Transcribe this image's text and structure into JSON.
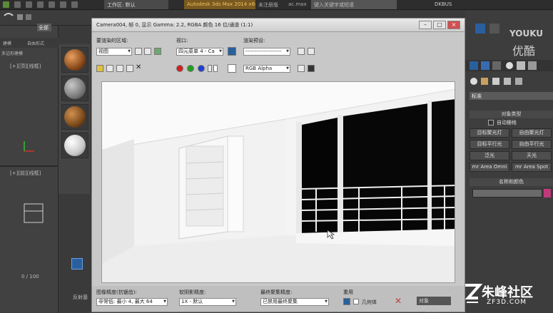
{
  "topbar": {
    "workspace": "工作区: 默认",
    "app_title": "Autodesk 3ds Max  2014 x64",
    "doc_name": "未注册版",
    "doc_file": "ac.max",
    "search_placeholder": "键入关键字或短语",
    "user": "DKBUS"
  },
  "left": {
    "selection_filter": "全部",
    "tab1": "建模",
    "tab2": "自由形式",
    "tab_sub": "多边形建模",
    "viewport_top_label": "[+][顶][线框]",
    "viewport_front_label": "[+][前][线框]",
    "frame_counter": "0 / 100",
    "bottom_label": "反射基"
  },
  "frame_window": {
    "title": "Camera004, 帧 0, 显示 Gamma: 2.2, RGBA 颜色 16 位/通道 (1:1)",
    "area_label": "要渲染的区域:",
    "area_value": "视图",
    "viewport_label": "视口:",
    "viewport_value": "四元菜单 4 - Ca",
    "preset_label": "渲染预设:",
    "preset_value": "--------------------",
    "channel_value": "RGB Alpha",
    "status": {
      "image_precision_label": "图像精度(抗锯齿):",
      "image_precision_value": "非常低: 最小 4, 最大 64",
      "soft_shadow_label": "软阴影精度:",
      "soft_shadow_value": "1X - 默认",
      "final_gather_label": "最终聚集精度:",
      "final_gather_value": "已禁用最终聚集",
      "reuse_label": "重用",
      "geometry_label": "几何体"
    }
  },
  "right": {
    "standard": "标准",
    "object_type": "对象类型",
    "autogrid": "自动栅格",
    "buttons": [
      "目标聚光灯",
      "自由聚光灯",
      "目标平行光",
      "自由平行光",
      "泛光",
      "天光",
      "mr Area Omni",
      "mr Area Spot"
    ],
    "name_color": "名称和颜色",
    "bottom_dropdown": "对象",
    "bottom_sub": "过滤器"
  },
  "watermarks": {
    "youku": "YOUKU",
    "youku_cn": "优酷",
    "zf_cn": "朱峰社区",
    "zf_url": "ZF3D.COM"
  },
  "colors": {
    "title_orange": "#7a5a20",
    "swatch_red": "#d42020",
    "swatch_green": "#20a020",
    "swatch_blue": "#2040d0",
    "name_swatch": "#c03a7a"
  }
}
